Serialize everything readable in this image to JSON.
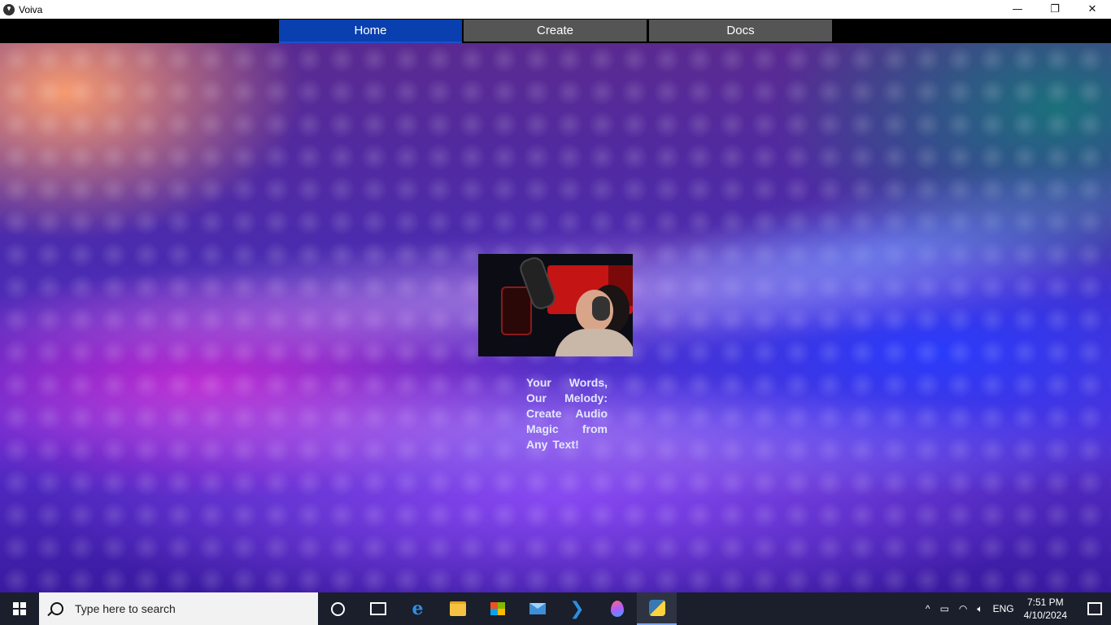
{
  "window": {
    "title": "Voiva",
    "controls": {
      "minimize": "—",
      "maximize": "❐",
      "close": "✕"
    }
  },
  "nav": {
    "tabs": [
      {
        "label": "Home",
        "active": true
      },
      {
        "label": "Create",
        "active": false
      },
      {
        "label": "Docs",
        "active": false
      }
    ]
  },
  "hero": {
    "tagline": "Your Words, Our Melody: Create Audio Magic from Any Text!"
  },
  "taskbar": {
    "search_placeholder": "Type here to search",
    "apps": [
      "cortana-icon",
      "task-view-icon",
      "edge-icon",
      "file-explorer-icon",
      "store-icon",
      "mail-icon",
      "vscode-icon",
      "paint-icon",
      "python-icon"
    ],
    "tray": {
      "chevron": "^",
      "language": "ENG",
      "time": "7:51 PM",
      "date": "4/10/2024"
    }
  }
}
